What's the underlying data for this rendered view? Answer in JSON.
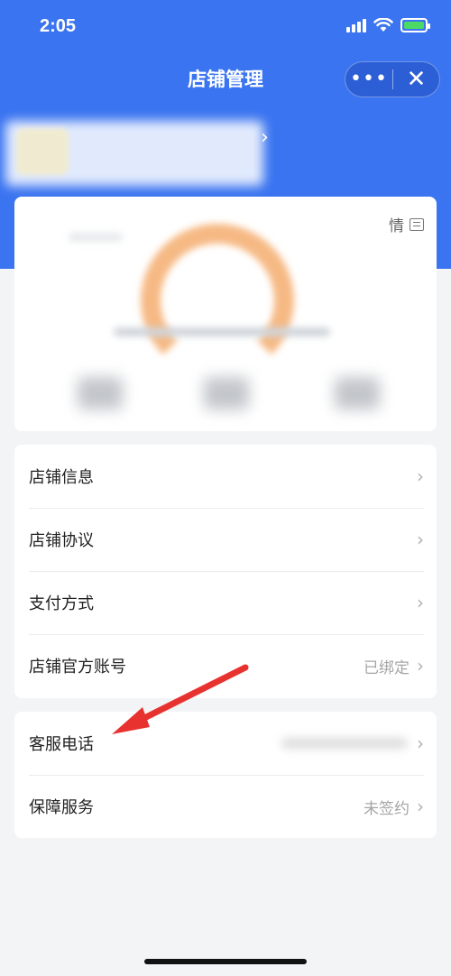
{
  "status_bar": {
    "time": "2:05"
  },
  "nav": {
    "title": "店铺管理",
    "more_label": "•••",
    "close_label": "✕"
  },
  "shop": {
    "chevron": "›"
  },
  "stats_card": {
    "detail_label": "情"
  },
  "menu_group_1": [
    {
      "label": "店铺信息",
      "value": "",
      "chevron": "›"
    },
    {
      "label": "店铺协议",
      "value": "",
      "chevron": "›"
    },
    {
      "label": "支付方式",
      "value": "",
      "chevron": "›"
    },
    {
      "label": "店铺官方账号",
      "value": "已绑定",
      "chevron": "›"
    }
  ],
  "menu_group_2": [
    {
      "label": "客服电话",
      "value": "",
      "chevron": "›"
    },
    {
      "label": "保障服务",
      "value": "未签约",
      "chevron": "›"
    }
  ],
  "colors": {
    "header": "#3a74f0",
    "background": "#f3f4f6",
    "arrow": "#e8322f"
  }
}
